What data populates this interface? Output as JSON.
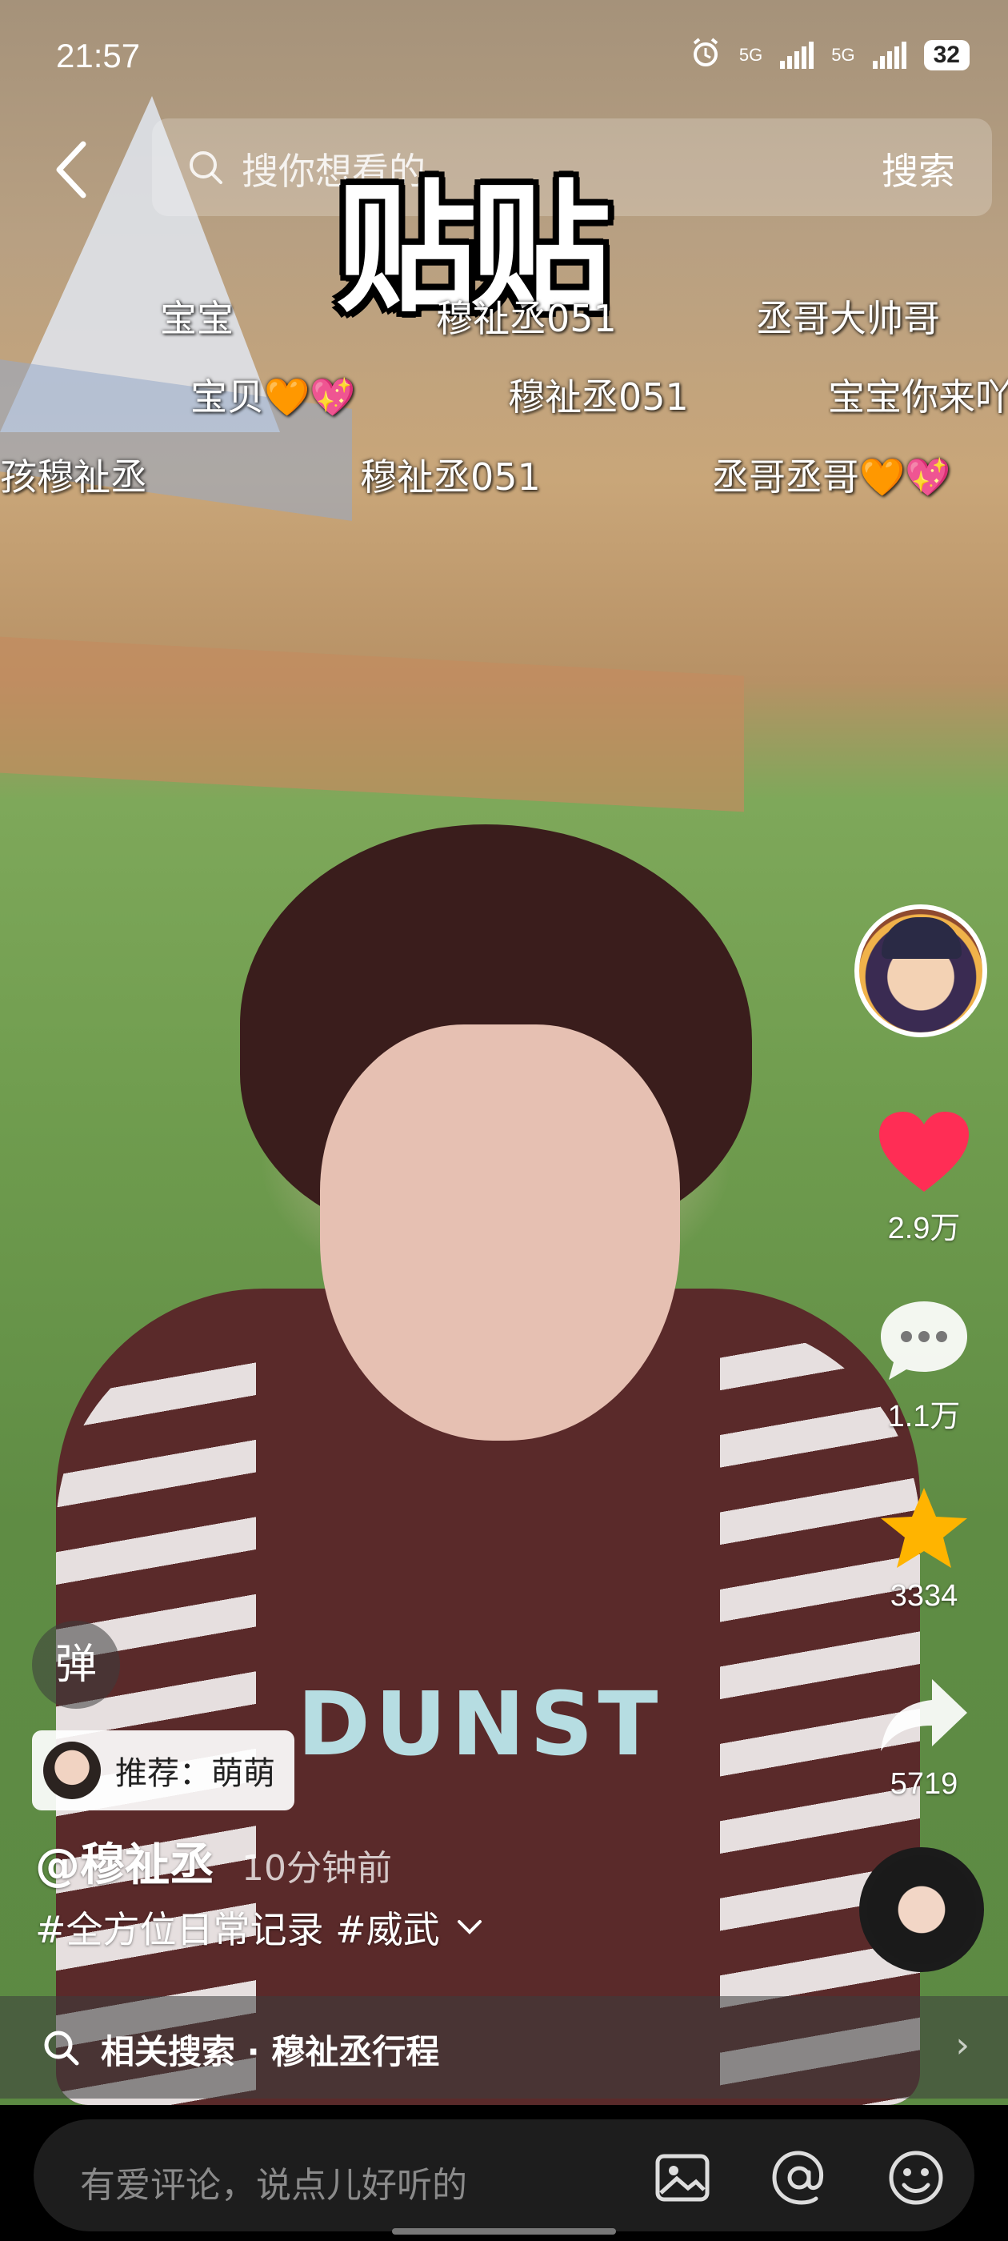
{
  "status_bar": {
    "time": "21:57",
    "network_1": "5G",
    "network_2": "5G",
    "battery": "32"
  },
  "search": {
    "placeholder": "搜你想看的",
    "button_label": "搜索"
  },
  "sticker_title": "贴贴",
  "danmaku": [
    {
      "text": "宝宝"
    },
    {
      "text": "穆祉丞051"
    },
    {
      "text": "丞哥大帅哥"
    },
    {
      "text": "宝贝🧡💖"
    },
    {
      "text": "穆祉丞051"
    },
    {
      "text": "宝宝你来吖"
    },
    {
      "text": "孩穆祉丞"
    },
    {
      "text": "穆祉丞051"
    },
    {
      "text": "丞哥丞哥🧡💖"
    }
  ],
  "right_rail": {
    "likes": "2.9万",
    "comments": "1.1万",
    "favorites": "3334",
    "shares": "5719",
    "like_color": "#ff2d55",
    "favorite_color": "#ffb400"
  },
  "danmaku_toggle": "弹",
  "recommend": {
    "label": "推荐：萌萌"
  },
  "post": {
    "author": "@穆祉丞",
    "time": "10分钟前",
    "caption": "#全方位日常记录 #威武",
    "expand_icon": "chevron-down-icon"
  },
  "related_search": {
    "label": "相关搜索",
    "separator": "·",
    "query": "穆祉丞行程"
  },
  "comment_bar": {
    "placeholder": "有爱评论，说点儿好听的",
    "icons": [
      "image-icon",
      "at-icon",
      "emoji-icon"
    ]
  },
  "overlay_logo_text": "DUNST"
}
